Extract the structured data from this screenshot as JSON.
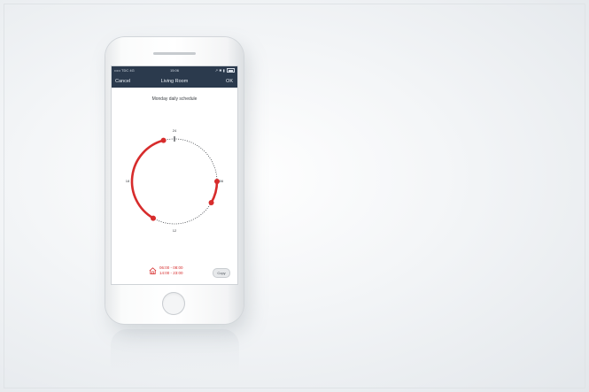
{
  "status_bar": {
    "carrier": "••••• TDC  4G",
    "time": "15:06",
    "indicators": "↗ ✱ ▮",
    "battery_icon": "battery-icon"
  },
  "nav_bar": {
    "cancel_label": "Cancel",
    "title": "Living Room",
    "ok_label": "OK"
  },
  "schedule": {
    "title": "Monday daily schedule",
    "dial_labels": {
      "top": "24",
      "right": "06",
      "bottom": "12",
      "left": "18"
    },
    "periods": [
      {
        "start": "06:00",
        "end": "08:00"
      },
      {
        "start": "14:00",
        "end": "23:00"
      }
    ],
    "period_lines": [
      "06:00 - 08:00",
      "14:00 - 23:00"
    ],
    "home_icon": "house-icon",
    "copy_label": "Copy"
  },
  "colors": {
    "header": "#2b3a4d",
    "accent": "#d72c2c",
    "dial_ticks": "#3b3f44"
  }
}
